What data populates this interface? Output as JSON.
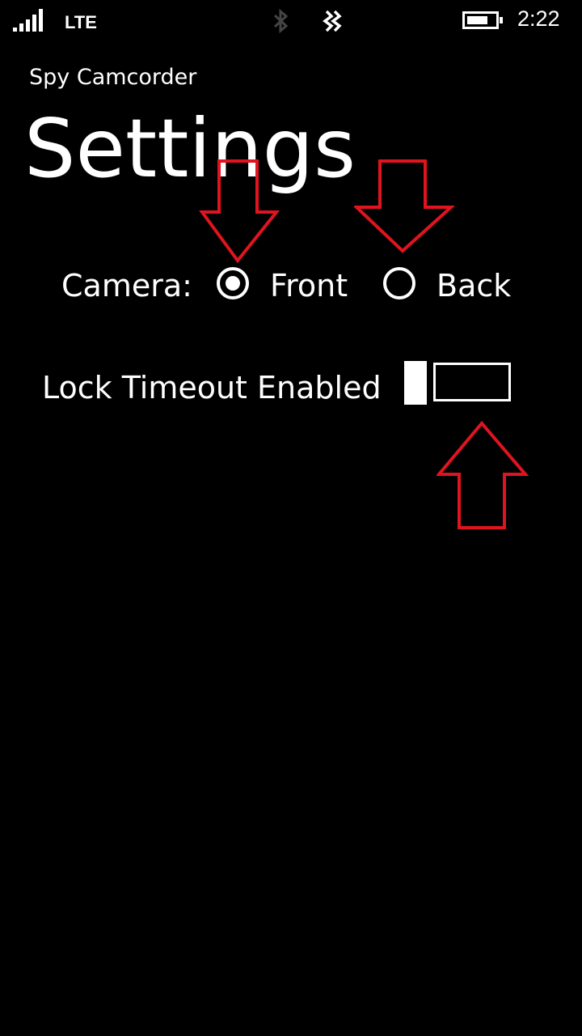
{
  "status_bar": {
    "network": "LTE",
    "time": "2:22",
    "icons": [
      "signal-icon",
      "bluetooth-icon",
      "nfc-icon",
      "battery-icon"
    ]
  },
  "app": {
    "name": "Spy Camcorder",
    "title": "Settings"
  },
  "camera": {
    "label": "Camera:",
    "options": [
      {
        "label": "Front",
        "selected": true
      },
      {
        "label": "Back",
        "selected": false
      }
    ]
  },
  "lock_timeout": {
    "label": "Lock Timeout Enabled",
    "enabled": false
  },
  "colors": {
    "background": "#000000",
    "foreground": "#ffffff",
    "annotation": "#e0141e"
  }
}
